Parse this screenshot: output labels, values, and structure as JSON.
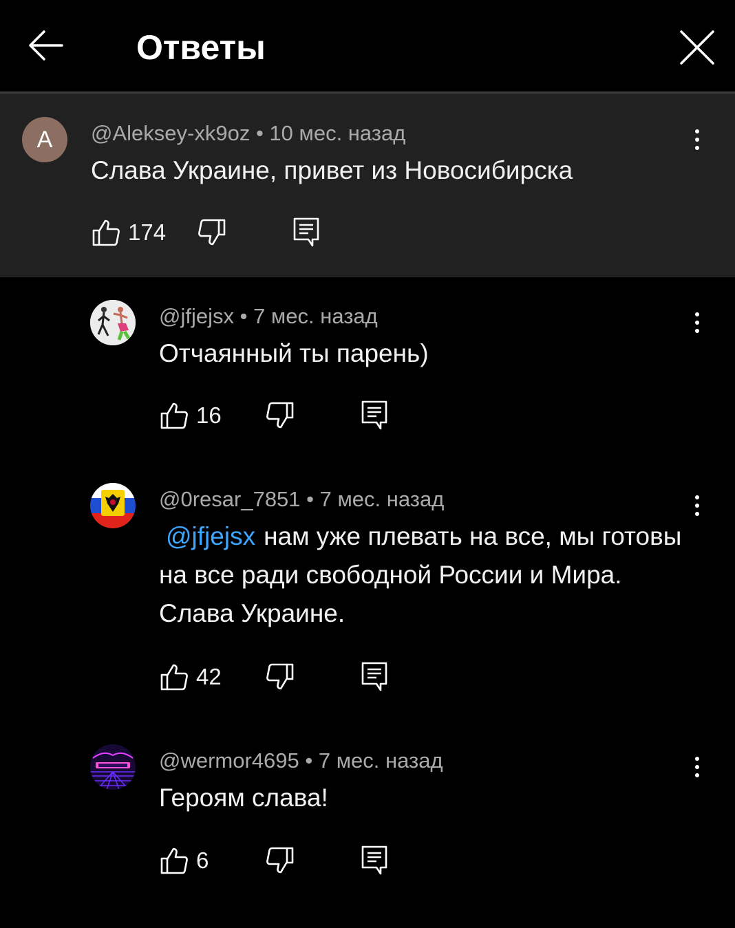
{
  "header": {
    "title": "Ответы",
    "back_icon": "arrow-left-icon",
    "close_icon": "close-icon"
  },
  "colors": {
    "background": "#000000",
    "parent_background": "#212121",
    "mention": "#3ea6ff",
    "meta_text": "#aaaaaa"
  },
  "parent_comment": {
    "avatar_letter": "A",
    "author": "@Aleksey-xk9oz",
    "time": "10 мес. назад",
    "text": "Слава Украине, привет из Новосибирска",
    "likes": "174"
  },
  "replies": [
    {
      "author": "@jfjejsx",
      "time": "7 мес. назад",
      "text": "Отчаянный ты парень)",
      "likes": "16"
    },
    {
      "author": "@0resar_7851",
      "time": "7 мес. назад",
      "mention": "@jfjejsx",
      "text": "нам уже плевать на все, мы готовы на все ради свободной России и Мира. Слава Украине.",
      "likes": "42"
    },
    {
      "author": "@wermor4695",
      "time": "7 мес. назад",
      "text": "Героям слава!",
      "likes": "6"
    }
  ]
}
